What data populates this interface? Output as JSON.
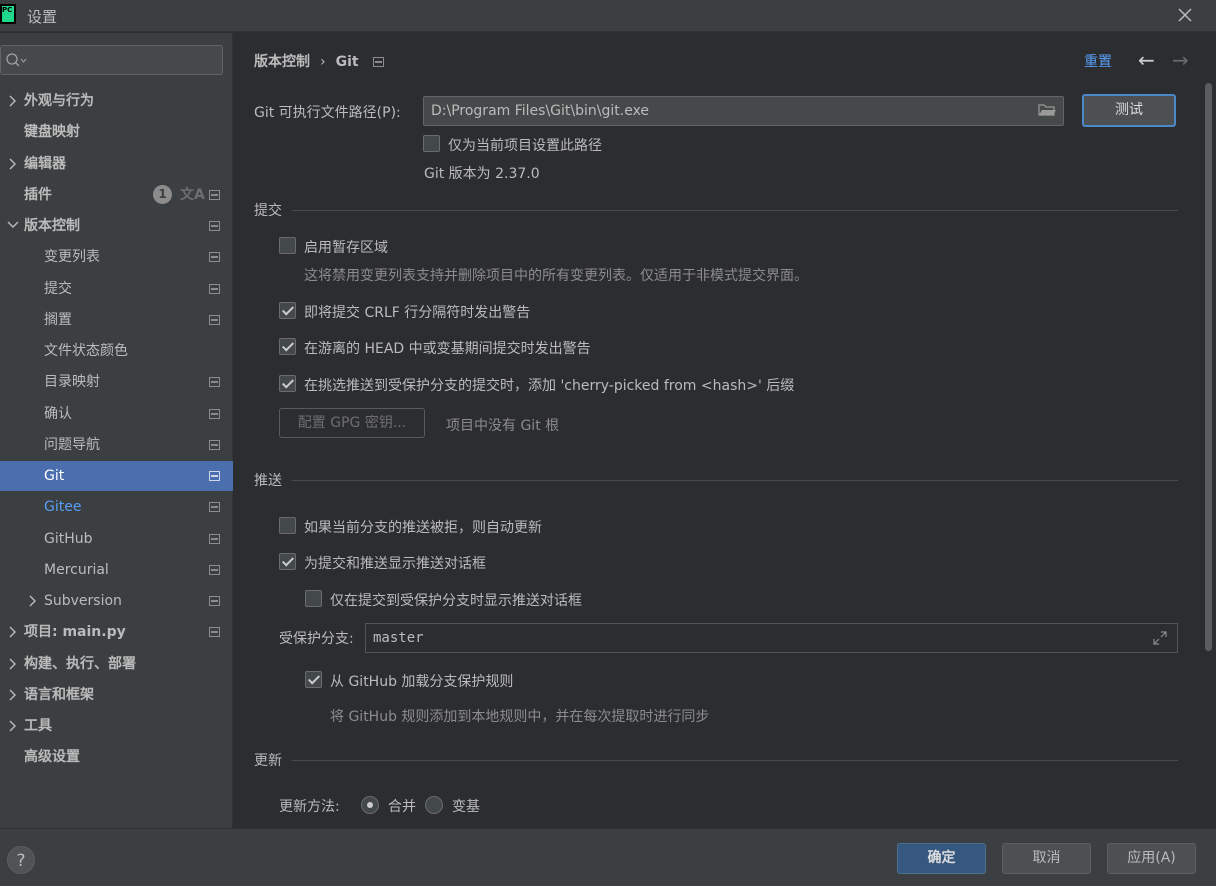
{
  "window": {
    "title": "设置"
  },
  "sidebar": {
    "search_placeholder": "",
    "plugins_badge": "1",
    "items": [
      {
        "label": "外观与行为"
      },
      {
        "label": "键盘映射"
      },
      {
        "label": "编辑器"
      },
      {
        "label": "插件"
      },
      {
        "label": "版本控制"
      },
      {
        "label": "变更列表"
      },
      {
        "label": "提交"
      },
      {
        "label": "搁置"
      },
      {
        "label": "文件状态颜色"
      },
      {
        "label": "目录映射"
      },
      {
        "label": "确认"
      },
      {
        "label": "问题导航"
      },
      {
        "label": "Git"
      },
      {
        "label": "Gitee"
      },
      {
        "label": "GitHub"
      },
      {
        "label": "Mercurial"
      },
      {
        "label": "Subversion"
      },
      {
        "label": "项目: main.py"
      },
      {
        "label": "构建、执行、部署"
      },
      {
        "label": "语言和框架"
      },
      {
        "label": "工具"
      },
      {
        "label": "高级设置"
      }
    ]
  },
  "header": {
    "breadcrumb_parent": "版本控制",
    "breadcrumb_sep": "›",
    "breadcrumb_current": "Git",
    "reset": "重置",
    "back": "←",
    "forward": "→"
  },
  "git": {
    "path_label": "Git 可执行文件路径(P):",
    "path_value": "D:\\Program Files\\Git\\bin\\git.exe",
    "test_button": "测试",
    "project_only_label": "仅为当前项目设置此路径",
    "version_text": "Git 版本为 2.37.0"
  },
  "commit": {
    "section": "提交",
    "staging_label": "启用暂存区域",
    "staging_hint": "这将禁用变更列表支持并删除项目中的所有变更列表。仅适用于非模式提交界面。",
    "crlf_label": "即将提交 CRLF 行分隔符时发出警告",
    "detached_label": "在游离的 HEAD 中或变基期间提交时发出警告",
    "cherry_label": "在挑选推送到受保护分支的提交时，添加 'cherry-picked from <hash>' 后缀",
    "gpg_button": "配置 GPG 密钥...",
    "gpg_hint": "项目中没有 Git 根"
  },
  "push": {
    "section": "推送",
    "auto_update_label": "如果当前分支的推送被拒，则自动更新",
    "show_dialog_label": "为提交和推送显示推送对话框",
    "protected_only_label": "仅在提交到受保护分支时显示推送对话框",
    "protected_branches_label": "受保护分支:",
    "protected_branches_value": "master",
    "github_rules_label": "从 GitHub 加载分支保护规则",
    "github_rules_hint": "将 GitHub 规则添加到本地规则中，并在每次提取时进行同步"
  },
  "update": {
    "section": "更新",
    "method_label": "更新方法:",
    "merge_label": "合并",
    "rebase_label": "变基"
  },
  "footer": {
    "help": "?",
    "ok": "确定",
    "cancel": "取消",
    "apply": "应用(A)"
  },
  "colors": {
    "selection": "#4b6eaf",
    "link": "#589df6",
    "background": "#2b2d30",
    "panel": "#3c3f41"
  }
}
